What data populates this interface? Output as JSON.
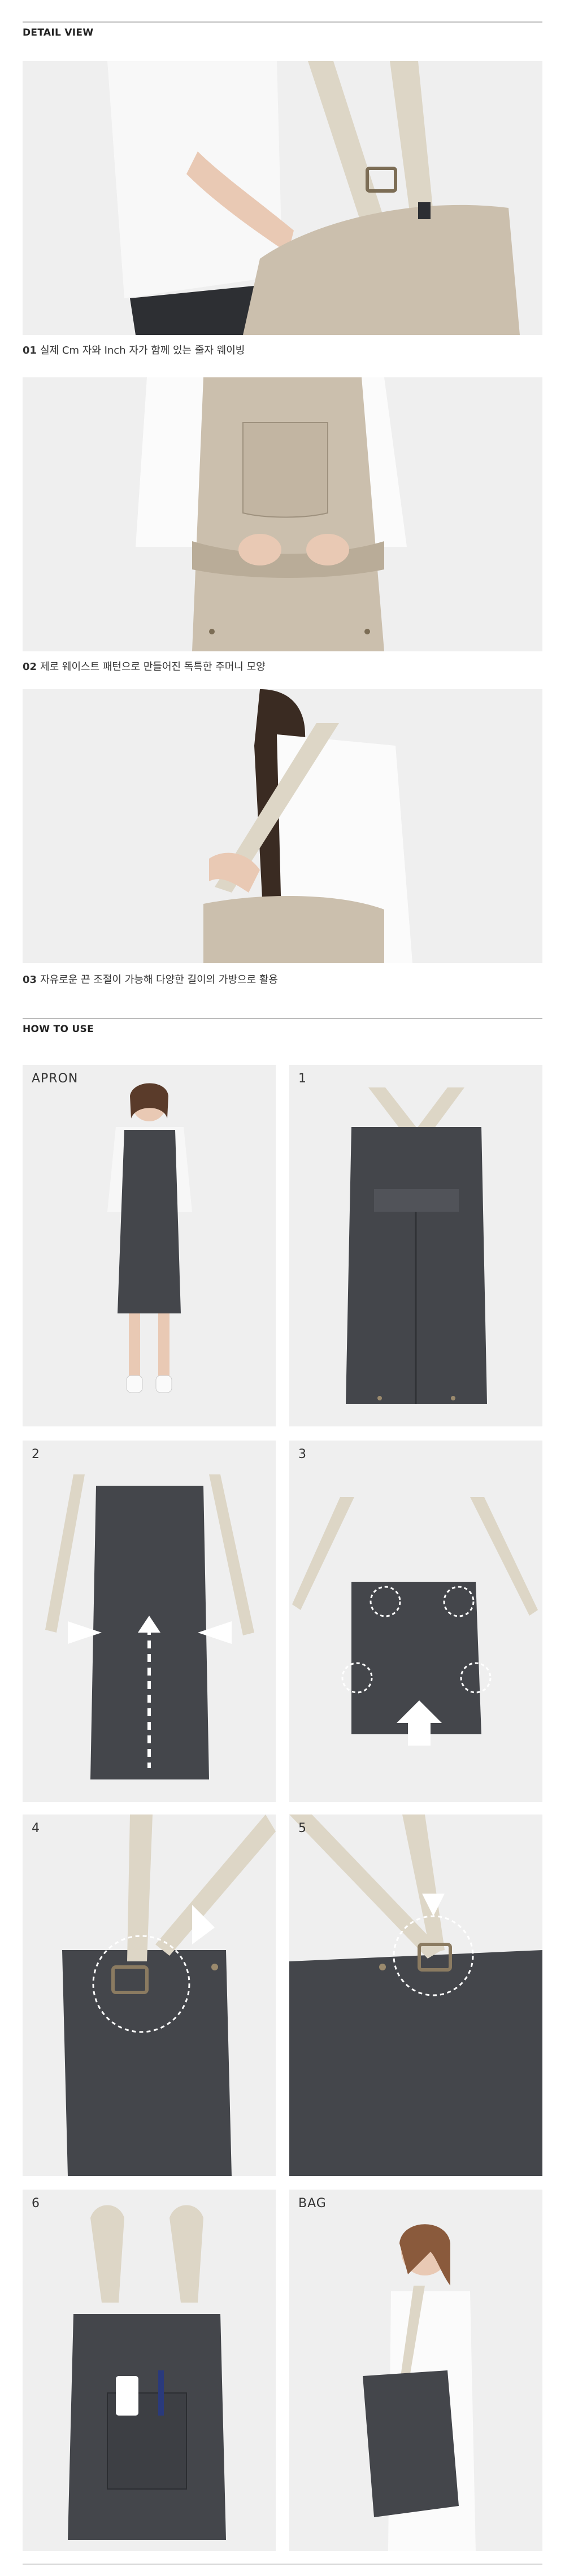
{
  "detail_view": {
    "heading": "DETAIL VIEW",
    "items": [
      {
        "num": "01",
        "text": "실제 Cm 자와 Inch 자가 함께 있는 줄자 웨이빙"
      },
      {
        "num": "02",
        "text": "제로 웨이스트 패턴으로 만들어진 독특한 주머니 모양"
      },
      {
        "num": "03",
        "text": "자유로운 끈 조절이 가능해 다양한 길이의 가방으로 활용"
      }
    ]
  },
  "how_to_use": {
    "heading": "HOW TO USE",
    "steps": [
      {
        "label": "APRON"
      },
      {
        "label": "1"
      },
      {
        "label": "2"
      },
      {
        "label": "3"
      },
      {
        "label": "4"
      },
      {
        "label": "5"
      },
      {
        "label": "6"
      },
      {
        "label": "BAG"
      }
    ]
  },
  "colors": {
    "canvas_beige": "#cbbfad",
    "denim_charcoal": "#44464b",
    "strap_cream": "#ddd6c6",
    "photo_bg": "#efefef"
  }
}
